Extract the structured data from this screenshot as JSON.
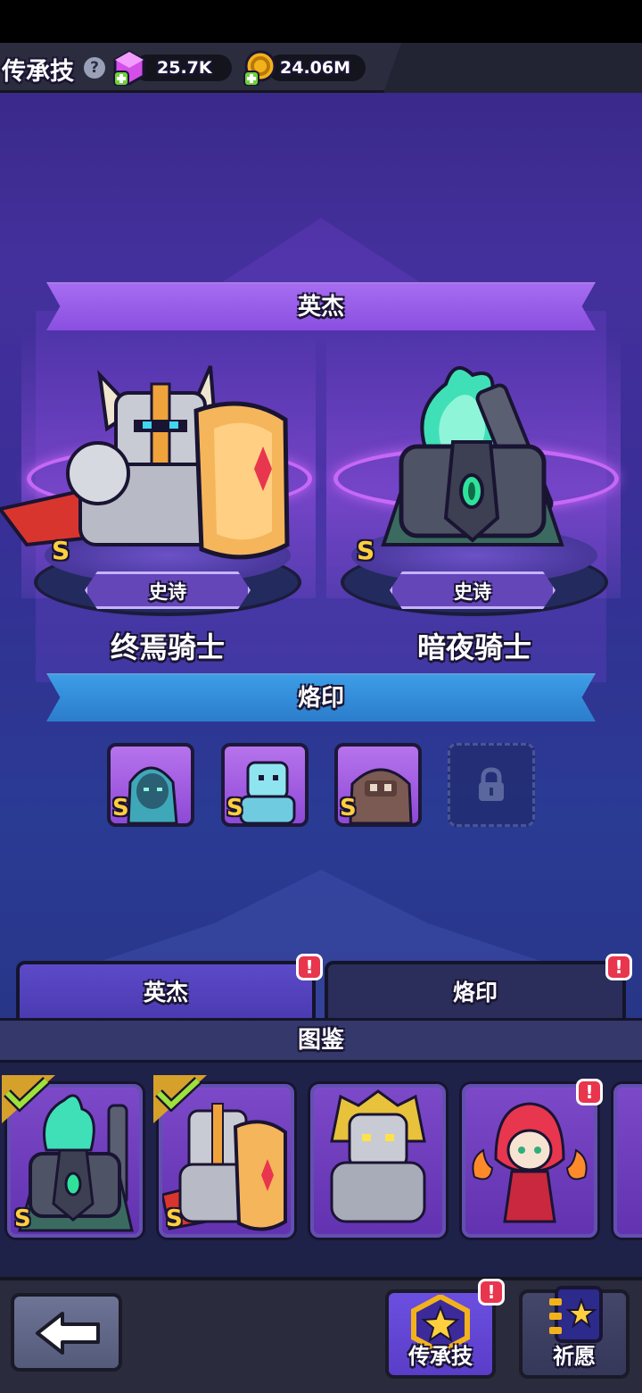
{
  "header": {
    "title": "传承技",
    "gems": "25.7K",
    "gold": "24.06M"
  },
  "hero_section": {
    "label": "英杰",
    "heroes": [
      {
        "name": "终焉骑士",
        "rarity": "史诗",
        "grade": "S"
      },
      {
        "name": "暗夜骑士",
        "rarity": "史诗",
        "grade": "S"
      }
    ]
  },
  "stamp_section": {
    "label": "烙印",
    "stamps": [
      {
        "grade": "S"
      },
      {
        "grade": "S"
      },
      {
        "grade": "S"
      }
    ]
  },
  "tabs": [
    {
      "label": "英杰",
      "badge": "!"
    },
    {
      "label": "烙印",
      "badge": "!"
    }
  ],
  "codex": {
    "label": "图鉴",
    "cards": [
      {
        "grade": "S",
        "selected": true
      },
      {
        "grade": "S",
        "selected": true
      },
      {
        "grade": "",
        "selected": false
      },
      {
        "grade": "",
        "selected": false,
        "badge": "!"
      }
    ]
  },
  "bottom_nav": {
    "legacy_label": "传承技",
    "legacy_badge": "!",
    "wish_label": "祈愿"
  },
  "colors": {
    "accent_purple": "#8a4fe0",
    "accent_blue": "#2b7dcc",
    "grade_gold": "#ffcf3d",
    "badge_red": "#e8364e"
  }
}
